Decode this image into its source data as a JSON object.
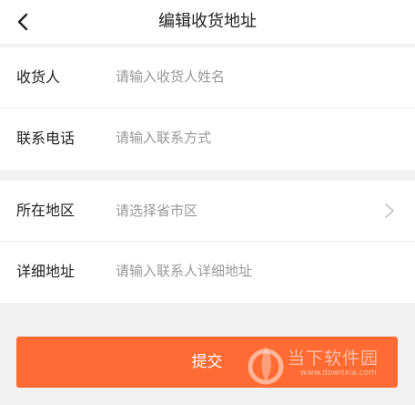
{
  "header": {
    "title": "编辑收货地址"
  },
  "form": {
    "recipient": {
      "label": "收货人",
      "placeholder": "请输入收货人姓名"
    },
    "phone": {
      "label": "联系电话",
      "placeholder": "请输入联系方式"
    },
    "region": {
      "label": "所在地区",
      "placeholder": "请选择省市区"
    },
    "address": {
      "label": "详细地址",
      "placeholder": "请输入联系人详细地址"
    }
  },
  "submit": {
    "label": "提交"
  },
  "watermark": {
    "text": "当下软件园",
    "url": "www.downxia.com"
  },
  "colors": {
    "accent": "#ff6b33",
    "background": "#f2f2f2"
  }
}
